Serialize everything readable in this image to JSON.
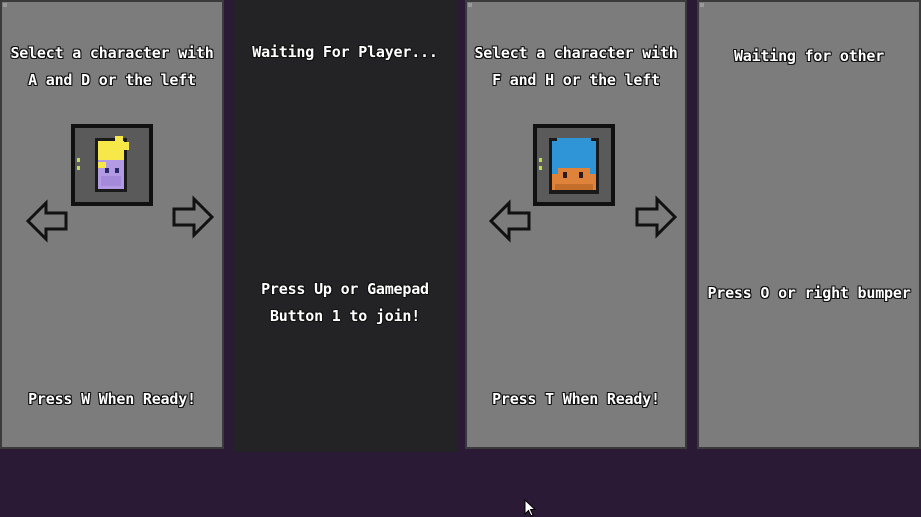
{
  "players": [
    {
      "state": "selecting",
      "instruction": "Select a character with\nA and D or the left",
      "ready_prompt": "Press W When Ready!",
      "character": "yellow-hair-purple-face"
    },
    {
      "state": "waiting",
      "status": "Waiting For Player...",
      "join_prompt": "Press Up or Gamepad\nButton 1 to join!"
    },
    {
      "state": "selecting",
      "instruction": "Select a character with\nF and H or the left",
      "ready_prompt": "Press T When Ready!",
      "character": "blue-hair-orange-face"
    },
    {
      "state": "waiting",
      "status": "Waiting for other",
      "join_prompt": "Press O or right bumper"
    }
  ],
  "colors": {
    "panel_active": "#7c7c7c",
    "panel_inactive": "#232224",
    "background": "#2a1a35",
    "text": "#ffffff"
  },
  "icons": [
    "left-arrow-icon",
    "right-arrow-icon",
    "mouse-cursor-icon"
  ]
}
